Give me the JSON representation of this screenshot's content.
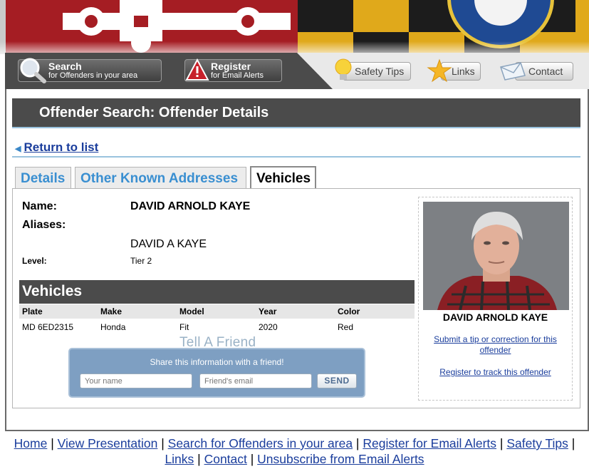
{
  "nav": {
    "search": {
      "line1": "Search",
      "line2": "for Offenders in your area",
      "icon": "magnifier-icon"
    },
    "register": {
      "line1": "Register",
      "line2": "for Email Alerts",
      "icon": "warning-icon"
    },
    "safety": {
      "label": "Safety Tips",
      "icon": "lightbulb-icon"
    },
    "links": {
      "label": "Links",
      "icon": "star-icon"
    },
    "contact": {
      "label": "Contact",
      "icon": "envelope-icon"
    }
  },
  "page_title": "Offender Search: Offender Details",
  "return_link": "Return to list",
  "tabs": [
    {
      "label": "Details",
      "active": false
    },
    {
      "label": "Other Known Addresses",
      "active": false
    },
    {
      "label": "Vehicles",
      "active": true
    }
  ],
  "offender": {
    "name_label": "Name:",
    "name": "DAVID ARNOLD KAYE",
    "aliases_label": "Aliases:",
    "alias": "DAVID A KAYE",
    "level_label": "Level:",
    "level": "Tier 2"
  },
  "vehicles": {
    "heading": "Vehicles",
    "columns": [
      "Plate",
      "Make",
      "Model",
      "Year",
      "Color"
    ],
    "rows": [
      {
        "plate": "MD 6ED2315",
        "make": "Honda",
        "model": "Fit",
        "year": "2020",
        "color": "Red"
      }
    ]
  },
  "tell_a_friend": {
    "title": "Tell A Friend",
    "message": "Share this information with a friend!",
    "name_placeholder": "Your name",
    "email_placeholder": "Friend's email",
    "send_label": "SEND"
  },
  "photo_card": {
    "name": "DAVID ARNOLD KAYE",
    "tip_link": "Submit a tip or correction for this offender",
    "track_link": "Register to track this offender"
  },
  "footer": {
    "links": [
      "Home",
      "View Presentation",
      "Search for Offenders in your area",
      "Register for Email Alerts",
      "Safety Tips",
      "Links",
      "Contact",
      "Unsubscribe from Email Alerts"
    ]
  },
  "colors": {
    "dark_bar": "#4b4b4b",
    "link": "#1a3d9c",
    "tab_inactive_text": "#3a8fd1",
    "accent_rule": "#9ac3de"
  }
}
